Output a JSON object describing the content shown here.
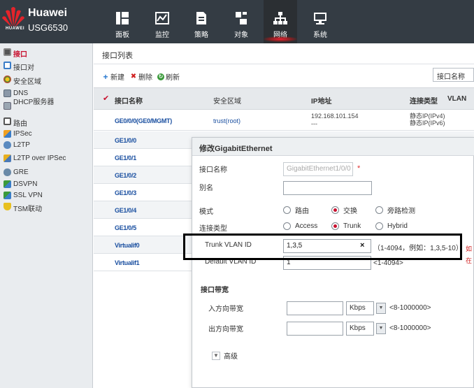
{
  "header": {
    "brand_small": "HUAWEI",
    "brand_name": "Huawei",
    "model": "USG6530",
    "nav": [
      {
        "label": "面板",
        "icon": "dashboard-icon"
      },
      {
        "label": "监控",
        "icon": "monitor-icon"
      },
      {
        "label": "策略",
        "icon": "policy-icon"
      },
      {
        "label": "对象",
        "icon": "object-icon"
      },
      {
        "label": "网络",
        "icon": "network-icon",
        "active": true
      },
      {
        "label": "系统",
        "icon": "system-icon"
      }
    ],
    "active_color": "#c8102e"
  },
  "sidebar": {
    "items": [
      {
        "label": "接口",
        "icon": "interface-icon",
        "active": true
      },
      {
        "label": "接口对",
        "icon": "interface-pair-icon"
      },
      {
        "label": "安全区域",
        "icon": "security-zone-icon"
      },
      {
        "label": "DNS",
        "icon": "dns-icon"
      },
      {
        "label": "DHCP服务器",
        "icon": "dhcp-server-icon"
      },
      {
        "label": "路由",
        "icon": "route-icon"
      },
      {
        "label": "IPSec",
        "icon": "ipsec-icon"
      },
      {
        "label": "L2TP",
        "icon": "l2tp-icon"
      },
      {
        "label": "L2TP over IPSec",
        "icon": "l2tp-over-ipsec-icon"
      },
      {
        "label": "GRE",
        "icon": "gre-icon"
      },
      {
        "label": "DSVPN",
        "icon": "dsvpn-icon"
      },
      {
        "label": "SSL VPN",
        "icon": "ssl-vpn-icon"
      },
      {
        "label": "TSM联动",
        "icon": "tsm-icon"
      }
    ]
  },
  "main": {
    "list_title": "接口列表",
    "toolbar": {
      "new_label": "新建",
      "delete_label": "删除",
      "refresh_label": "刷新"
    },
    "search_field": "接口名称",
    "columns": [
      "接口名称",
      "安全区域",
      "IP地址",
      "连接类型",
      "VLAN"
    ],
    "rows": [
      {
        "name": "GE0/0/0(GE0/MGMT)",
        "zone": "trust(root)",
        "ip": "192.168.101.154",
        "ip2": "---",
        "conn": "静态IP(IPv4)",
        "conn2": "静态IP(IPv6)"
      },
      {
        "name": "GE1/0/0"
      },
      {
        "name": "GE1/0/1"
      },
      {
        "name": "GE1/0/2"
      },
      {
        "name": "GE1/0/3"
      },
      {
        "name": "GE1/0/4"
      },
      {
        "name": "GE1/0/5"
      },
      {
        "name": "Virtualif0"
      },
      {
        "name": "Virtualif1"
      }
    ]
  },
  "dialog": {
    "title": "修改GigabitEthernet",
    "fields": {
      "ifname_label": "接口名称",
      "ifname_value": "GigabitEthernet1/0/0",
      "required_mark": "*",
      "alias_label": "别名",
      "alias_value": "",
      "mode_label": "模式",
      "mode_options": [
        "路由",
        "交换",
        "旁路检测"
      ],
      "mode_selected": "交换",
      "conn_label": "连接类型",
      "conn_options": [
        "Access",
        "Trunk",
        "Hybrid"
      ],
      "conn_selected": "Trunk",
      "trunk_label": "Trunk VLAN ID",
      "trunk_value": "1,3,5",
      "trunk_clear": "×",
      "trunk_hint": "（1-4094，例如：1,3,5-10）",
      "default_vlan_label": "Default VLAN ID",
      "default_vlan_value": "1",
      "default_vlan_hint": "<1-4094>",
      "bandwidth_section": "接口带宽",
      "inbound_label": "入方向带宽",
      "outbound_label": "出方向带宽",
      "bw_unit": "Kbps",
      "bw_hint": "<8-1000000>",
      "advanced_label": "高级"
    },
    "right_clip": [
      "如",
      "在"
    ]
  }
}
